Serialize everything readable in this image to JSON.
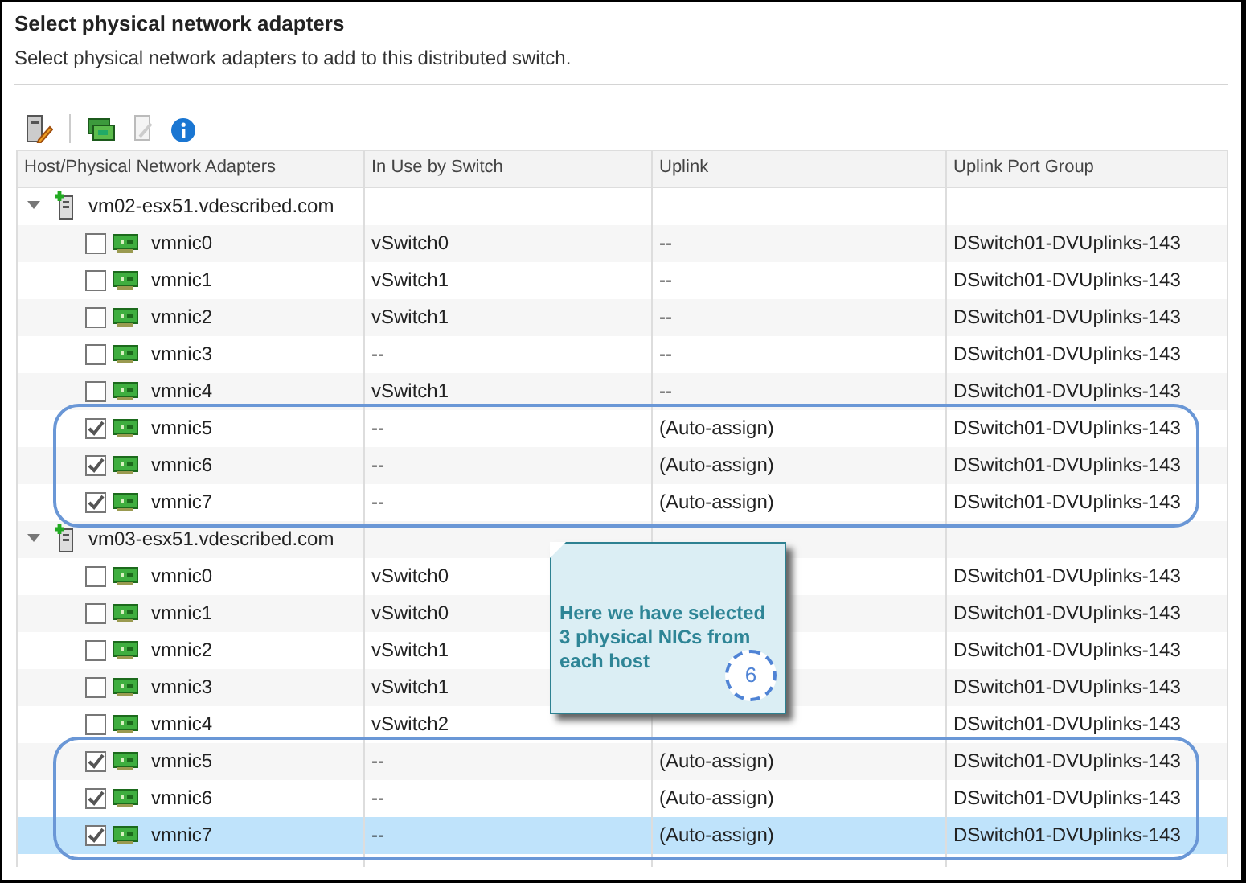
{
  "title": "Select physical network adapters",
  "subtitle": "Select physical network adapters to add to this distributed switch.",
  "columns": [
    "Host/Physical Network Adapters",
    "In Use by Switch",
    "Uplink",
    "Uplink Port Group"
  ],
  "hosts": [
    {
      "name": "vm02-esx51.vdescribed.com",
      "expanded": true,
      "adapters": [
        {
          "name": "vmnic0",
          "checked": false,
          "selected": false,
          "circled": false,
          "in_use": "vSwitch0",
          "uplink": "--",
          "port_group": "DSwitch01-DVUplinks-143"
        },
        {
          "name": "vmnic1",
          "checked": false,
          "selected": false,
          "circled": false,
          "in_use": "vSwitch1",
          "uplink": "--",
          "port_group": "DSwitch01-DVUplinks-143"
        },
        {
          "name": "vmnic2",
          "checked": false,
          "selected": false,
          "circled": false,
          "in_use": "vSwitch1",
          "uplink": "--",
          "port_group": "DSwitch01-DVUplinks-143"
        },
        {
          "name": "vmnic3",
          "checked": false,
          "selected": false,
          "circled": false,
          "in_use": "--",
          "uplink": "--",
          "port_group": "DSwitch01-DVUplinks-143"
        },
        {
          "name": "vmnic4",
          "checked": false,
          "selected": false,
          "circled": false,
          "in_use": "vSwitch1",
          "uplink": "--",
          "port_group": "DSwitch01-DVUplinks-143"
        },
        {
          "name": "vmnic5",
          "checked": true,
          "selected": false,
          "circled": true,
          "in_use": "--",
          "uplink": "(Auto-assign)",
          "port_group": "DSwitch01-DVUplinks-143"
        },
        {
          "name": "vmnic6",
          "checked": true,
          "selected": false,
          "circled": true,
          "in_use": "--",
          "uplink": "(Auto-assign)",
          "port_group": "DSwitch01-DVUplinks-143"
        },
        {
          "name": "vmnic7",
          "checked": true,
          "selected": false,
          "circled": true,
          "in_use": "--",
          "uplink": "(Auto-assign)",
          "port_group": "DSwitch01-DVUplinks-143"
        }
      ]
    },
    {
      "name": "vm03-esx51.vdescribed.com",
      "expanded": true,
      "adapters": [
        {
          "name": "vmnic0",
          "checked": false,
          "selected": false,
          "circled": false,
          "in_use": "vSwitch0",
          "port_group": "DSwitch01-DVUplinks-143"
        },
        {
          "name": "vmnic1",
          "checked": false,
          "selected": false,
          "circled": false,
          "in_use": "vSwitch0",
          "port_group": "DSwitch01-DVUplinks-143"
        },
        {
          "name": "vmnic2",
          "checked": false,
          "selected": false,
          "circled": false,
          "in_use": "vSwitch1",
          "port_group": "DSwitch01-DVUplinks-143"
        },
        {
          "name": "vmnic3",
          "checked": false,
          "selected": false,
          "circled": false,
          "in_use": "vSwitch1",
          "port_group": "DSwitch01-DVUplinks-143"
        },
        {
          "name": "vmnic4",
          "checked": false,
          "selected": false,
          "circled": false,
          "in_use": "vSwitch2",
          "port_group": "DSwitch01-DVUplinks-143"
        },
        {
          "name": "vmnic5",
          "checked": true,
          "selected": false,
          "circled": true,
          "in_use": "--",
          "uplink": "(Auto-assign)",
          "port_group": "DSwitch01-DVUplinks-143"
        },
        {
          "name": "vmnic6",
          "checked": true,
          "selected": false,
          "circled": true,
          "in_use": "--",
          "uplink": "(Auto-assign)",
          "port_group": "DSwitch01-DVUplinks-143"
        },
        {
          "name": "vmnic7",
          "checked": true,
          "selected": true,
          "circled": true,
          "in_use": "--",
          "uplink": "(Auto-assign)",
          "port_group": "DSwitch01-DVUplinks-143"
        }
      ]
    }
  ],
  "callout": {
    "text": "Here we have selected 3 physical NICs from each host",
    "step": "6"
  }
}
